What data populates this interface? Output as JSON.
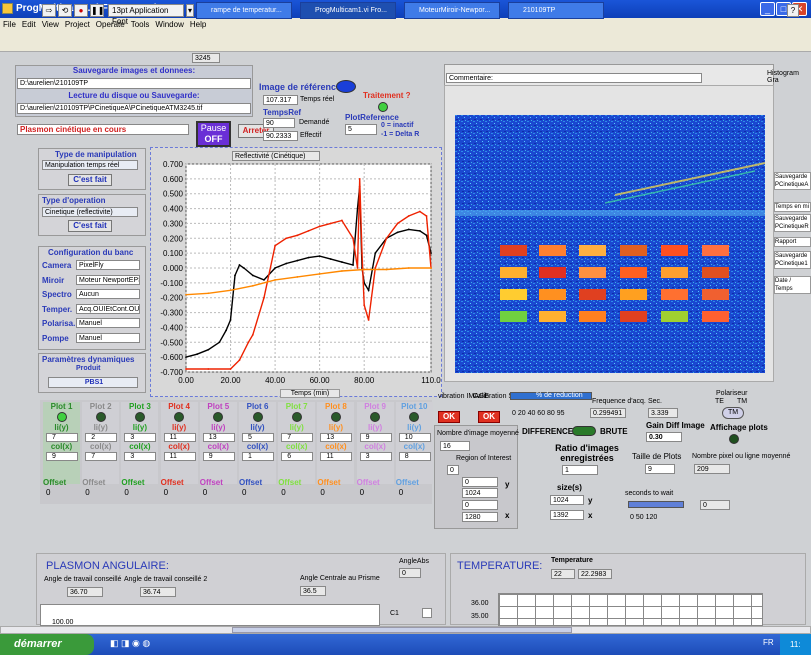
{
  "window": {
    "title": "ProgMulticam1.vi Front Panel"
  },
  "menu": [
    "File",
    "Edit",
    "View",
    "Project",
    "Operate",
    "Tools",
    "Window",
    "Help"
  ],
  "toolbar": {
    "font": "13pt Application Font",
    "counter": "3245"
  },
  "sauvegarde": {
    "title": "Sauvegarde images et donnees:",
    "path": "D:\\aurelien\\210109TP",
    "read_title": "Lecture du disque ou Sauvegarde:",
    "read_path": "D:\\aurelien\\210109TP\\PCinetiqueA\\PCinetiqueATM3245.tif"
  },
  "status": {
    "text": "Plasmon cinétique en cours",
    "pause": "Pause",
    "pause_state": "OFF",
    "stop": "Arreter"
  },
  "reference": {
    "title": "Image de référence",
    "temps_reel": "107.317",
    "temps_reel_lbl": "Temps réel",
    "temps_ref_lbl": "TempsRef",
    "demande": "90",
    "demande_lbl": "Demandé",
    "effectif": "90.2333",
    "effectif_lbl": "Effectif",
    "traitement": "Traitement ?",
    "plotref_lbl": "PlotReference",
    "plotref": "5",
    "inactif": "0 = inactif",
    "delta": "-1 = Delta R"
  },
  "manip": {
    "title": "Type de manipulation",
    "value": "Manipulation temps réel",
    "done": "C'est fait"
  },
  "operation": {
    "title": "Type d'operation",
    "value": "Cinetique (reflectivite)",
    "done": "C'est fait"
  },
  "banc": {
    "title": "Configuration du banc",
    "rows": [
      {
        "k": "Camera",
        "v": "PixelFly"
      },
      {
        "k": "Miroir",
        "v": "Moteur NewportEPS"
      },
      {
        "k": "Spectro",
        "v": "Aucun"
      },
      {
        "k": "Temper.",
        "v": "Acq.OUIEtCont.OUI"
      },
      {
        "k": "Polarisa.",
        "v": "Manuel"
      },
      {
        "k": "Pompe",
        "v": "Manuel"
      }
    ]
  },
  "dyn": {
    "title": "Paramètres dynamiques",
    "produit": "Produit",
    "value": "PBS1"
  },
  "chart_data": {
    "type": "line",
    "title": "Reflectivité (Cinétique)",
    "xlabel": "Temps (min)",
    "x_ticks": [
      "0.00",
      "20.00",
      "40.00",
      "60.00",
      "80.00",
      "110.0"
    ],
    "y_ticks": [
      "0.700",
      "0.600",
      "0.500",
      "0.400",
      "0.300",
      "0.200",
      "0.100",
      "0.000",
      "-0.100",
      "-0.200",
      "-0.300",
      "-0.400",
      "-0.500",
      "-0.600",
      "-0.700"
    ],
    "xlim": [
      0,
      110
    ],
    "ylim": [
      -0.7,
      0.7
    ],
    "grid": true,
    "series": [
      {
        "color": "#000000",
        "x": [
          0,
          5,
          10,
          15,
          18,
          20,
          22,
          24,
          26,
          30,
          35,
          40,
          45,
          50,
          55,
          60,
          65,
          70,
          75,
          77,
          78,
          79,
          80,
          82,
          85,
          90,
          95,
          100,
          105,
          108,
          110
        ],
        "values": [
          -0.6,
          -0.58,
          -0.55,
          -0.5,
          -0.42,
          -0.35,
          -0.05,
          0.02,
          0.0,
          -0.05,
          -0.08,
          0.0,
          0.03,
          0.05,
          0.07,
          0.08,
          0.06,
          0.04,
          0.02,
          0.4,
          0.55,
          0.0,
          -0.1,
          -0.15,
          0.1,
          0.2,
          0.24,
          0.26,
          0.25,
          0.22,
          0.1
        ]
      },
      {
        "color": "#ee2200",
        "x": [
          0,
          10,
          20,
          24,
          28,
          30,
          35,
          40,
          45,
          50,
          55,
          60,
          65,
          70,
          75,
          77,
          78,
          79,
          80,
          82,
          85,
          90,
          95,
          100,
          105,
          108,
          110
        ],
        "values": [
          -0.68,
          -0.68,
          -0.68,
          -0.62,
          -0.5,
          -0.45,
          -0.2,
          0.15,
          0.2,
          0.22,
          0.25,
          0.28,
          0.3,
          0.32,
          0.2,
          0.0,
          0.6,
          0.1,
          -0.25,
          -0.35,
          0.0,
          0.2,
          0.3,
          0.35,
          0.38,
          0.35,
          0.0
        ]
      },
      {
        "color": "#ff8800",
        "x": [
          0,
          10,
          20,
          30,
          40,
          50,
          60,
          70,
          80,
          90,
          100,
          110
        ],
        "values": [
          -0.18,
          -0.17,
          -0.15,
          -0.12,
          -0.08,
          -0.06,
          -0.04,
          -0.02,
          -0.01,
          -0.01,
          0.0,
          0.0
        ]
      }
    ]
  },
  "image_panel": {
    "comment_lbl": "Commentaire:",
    "hist_lbl": "Histogram Gra",
    "side": [
      "Sauvegarde PCinetiqueA",
      "Temps en mi",
      "Sauvegarde PCinetiqueR",
      "Rapport",
      "Sauvegarde PCinetique1",
      "Date / Temps"
    ]
  },
  "controls": {
    "vibration": "vibration IMAGE",
    "calibration": "Calibration Spectrale",
    "ok": "OK",
    "reduction": "% de reduction",
    "red_ticks": "0 20 40 60 80 95",
    "freq_lbl": "Frequence d'acq.",
    "freq": "0.299491",
    "sec_lbl": "Sec.",
    "sec": "3.339",
    "polar": "Polariseur",
    "te": "TE",
    "tm": "TM",
    "tm_btn": "TM",
    "difference": "DIFFERENCE",
    "brute": "BRUTE",
    "gain_lbl": "Gain Diff Image",
    "gain": "0.30",
    "affichage": "Affichage plots",
    "nb_img_lbl": "Nombre d'image moyenné",
    "nb_img": "16",
    "ratio_lbl": "Ratio d'images enregistrées",
    "ratio": "1",
    "taille_lbl": "Taille de Plots",
    "taille": "9",
    "nb_pix_lbl": "Nombre pixel ou ligne moyenné",
    "nb_pix": "209",
    "roi_lbl": "Region of Interest",
    "roi": [
      "0",
      "0",
      "1024",
      "0",
      "1280"
    ],
    "roi_y": "y",
    "roi_x": "x",
    "size_lbl": "size(s)",
    "size_y": "1024",
    "size_x": "1392",
    "wait_lbl": "seconds to wait",
    "wait": "0",
    "wait_ticks": "0 50 120"
  },
  "plots": [
    {
      "name": "Plot 1",
      "color": "#2a8a2a",
      "li": "7",
      "col": "9",
      "off": "0"
    },
    {
      "name": "Plot 2",
      "color": "#8a8a8a",
      "li": "2",
      "col": "7",
      "off": "0"
    },
    {
      "name": "Plot 3",
      "color": "#20a020",
      "li": "3",
      "col": "3",
      "off": "0"
    },
    {
      "name": "Plot 4",
      "color": "#e03020",
      "li": "11",
      "col": "11",
      "off": "0"
    },
    {
      "name": "Plot 5",
      "color": "#c040c0",
      "li": "13",
      "col": "9",
      "off": "0"
    },
    {
      "name": "Plot 6",
      "color": "#3050c0",
      "li": "5",
      "col": "1",
      "off": "0"
    },
    {
      "name": "Plot 7",
      "color": "#80e040",
      "li": "7",
      "col": "6",
      "off": "0"
    },
    {
      "name": "Plot 8",
      "color": "#ff9020",
      "li": "13",
      "col": "11",
      "off": "0"
    },
    {
      "name": "Plot 9",
      "color": "#d080e0",
      "li": "9",
      "col": "3",
      "off": "0"
    },
    {
      "name": "Plot 10",
      "color": "#60a0e0",
      "li": "10",
      "col": "8",
      "off": "0"
    }
  ],
  "plot_labels": {
    "li": "li(y)",
    "col": "col(x)",
    "offset": "Offset"
  },
  "angulaire": {
    "title": "PLASMON ANGULAIRE:",
    "a1_lbl": "Angle de travail conseillé",
    "a1": "36.70",
    "a2_lbl": "Angle de travail conseillé 2",
    "a2": "36.74",
    "centrale_lbl": "Angle Centrale au Prisme",
    "centrale": "36.5",
    "abs_lbl": "AngleAbs",
    "abs": "0",
    "c1": "C1",
    "y100": "100.00"
  },
  "temperature": {
    "title": "TEMPERATURE:",
    "lbl": "Temperature",
    "t1": "22",
    "t2": "22.2983",
    "y1": "36.00",
    "y2": "35.00"
  },
  "taskbar": {
    "start": "démarrer",
    "tasks": [
      "rampe de temperatur...",
      "ProgMulticam1.vi Fro...",
      "MoteurMiroir-Newpor...",
      "210109TP"
    ],
    "lang": "FR",
    "clock": "11:"
  }
}
